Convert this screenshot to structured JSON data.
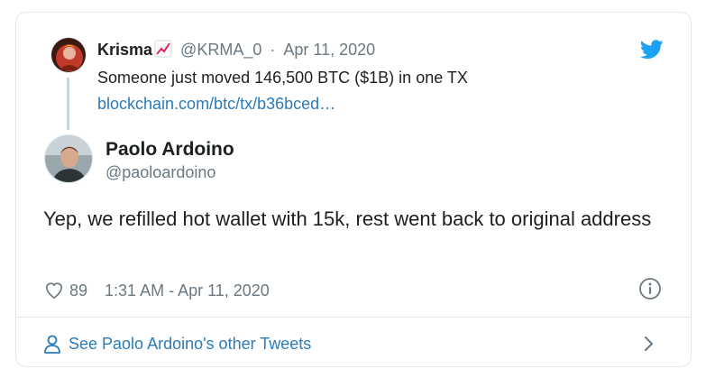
{
  "quoted_tweet": {
    "author_name": "Krisma",
    "author_emoji_icon": "chart-increasing-icon",
    "author_handle": "@KRMA_0",
    "separator": "·",
    "date": "Apr 11, 2020",
    "text": "Someone just moved 146,500 BTC ($1B) in one TX",
    "link": "blockchain.com/btc/tx/b36bced…"
  },
  "tweet": {
    "author_name": "Paolo Ardoino",
    "author_handle": "@paoloardoino",
    "text": "Yep, we refilled hot wallet with 15k, rest went back to original address",
    "like_count": "89",
    "timestamp": "1:31 AM - Apr 11, 2020"
  },
  "footer": {
    "link_label": "See Paolo Ardoino's other Tweets"
  },
  "icons": {
    "brand": "twitter-bird-icon",
    "like": "heart-icon",
    "info": "info-icon",
    "person": "person-icon",
    "chevron": "chevron-right-icon"
  },
  "colors": {
    "brand_blue": "#1da1f2",
    "link_blue": "#2b7bb9",
    "secondary_text": "#697882",
    "primary_text": "#1c2022",
    "border": "#e1e8ed"
  }
}
